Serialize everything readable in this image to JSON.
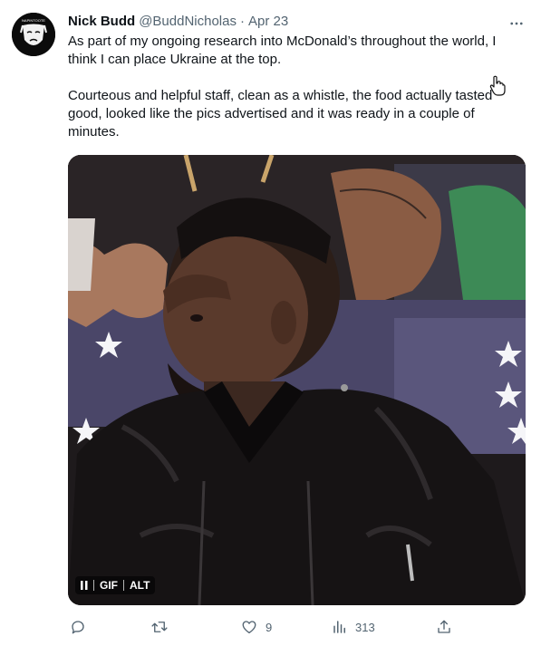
{
  "tweet": {
    "author": {
      "name": "Nick Budd",
      "handle": "@BuddNicholas",
      "avatar_text": "NAPINTOOTE"
    },
    "separator": "·",
    "date": "Apr 23",
    "more_icon": "more-horizontal-icon",
    "paragraphs": [
      "As part of my ongoing research into McDonald’s throughout the world, I think I can place Ukraine at the top.",
      "Courteous and helpful staff, clean as a whistle, the food actually tasted good, looked like the pics advertised and it was ready in a couple of minutes."
    ],
    "media": {
      "type": "gif",
      "pause_icon": "pause-icon",
      "gif_label": "GIF",
      "alt_label": "ALT"
    },
    "actions": {
      "reply": {
        "icon": "reply-icon",
        "count": ""
      },
      "retweet": {
        "icon": "retweet-icon",
        "count": ""
      },
      "like": {
        "icon": "heart-icon",
        "count": "9"
      },
      "views": {
        "icon": "views-icon",
        "count": "313"
      },
      "share": {
        "icon": "share-icon",
        "count": ""
      }
    }
  },
  "colors": {
    "text_primary": "#0f1419",
    "text_secondary": "#536471",
    "background": "#ffffff",
    "media_dark": "#1e1a1c"
  }
}
